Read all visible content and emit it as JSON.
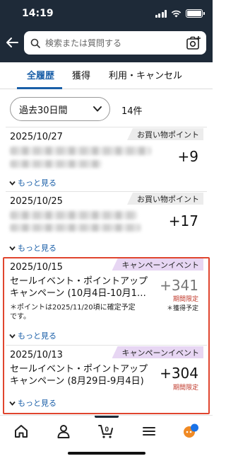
{
  "status_bar": {
    "time": "14:19"
  },
  "search": {
    "placeholder": "検索または質問する"
  },
  "tabs": [
    {
      "label": "全履歴",
      "active": true
    },
    {
      "label": "獲得",
      "active": false
    },
    {
      "label": "利用・キャンセル",
      "active": false
    }
  ],
  "filter": {
    "selected": "過去30日間",
    "count": "14件"
  },
  "items": [
    {
      "date": "2025/10/27",
      "badge": "お買い物ポイント",
      "points": "+9",
      "more": "もっと見る"
    },
    {
      "date": "2025/10/25",
      "badge": "お買い物ポイント",
      "points": "+17",
      "more": "もっと見る"
    },
    {
      "date": "2025/10/15",
      "badge": "キャンペーンイベント",
      "title_lines": [
        "セールイベント・ポイントアップ",
        "キャンペーン (10月4日-10月1…"
      ],
      "points": "+341",
      "status": "期間限定",
      "status2": "＊獲得予定",
      "note_lines": [
        "＊ポイントは2025/11/20頃に確定予定",
        "です。"
      ],
      "more": "もっと見る"
    },
    {
      "date": "2025/10/13",
      "badge": "キャンペーンイベント",
      "title_lines": [
        "セールイベント・ポイントアップ",
        "キャンペーン (8月29日-9月4日)"
      ],
      "points": "+304",
      "status": "期間限定",
      "more": "もっと見る"
    }
  ],
  "bottom_nav": [
    {
      "icon": "home-icon"
    },
    {
      "icon": "account-icon"
    },
    {
      "icon": "cart-icon",
      "badge": "0"
    },
    {
      "icon": "menu-icon",
      "active": true
    },
    {
      "icon": "ai-assistant-icon"
    }
  ],
  "colors": {
    "header": "#1e2a38",
    "accent": "#1a5fa8",
    "highlight": "#e0452e",
    "limited": "#c0392b",
    "campaign_badge": "#e7d6f3"
  }
}
